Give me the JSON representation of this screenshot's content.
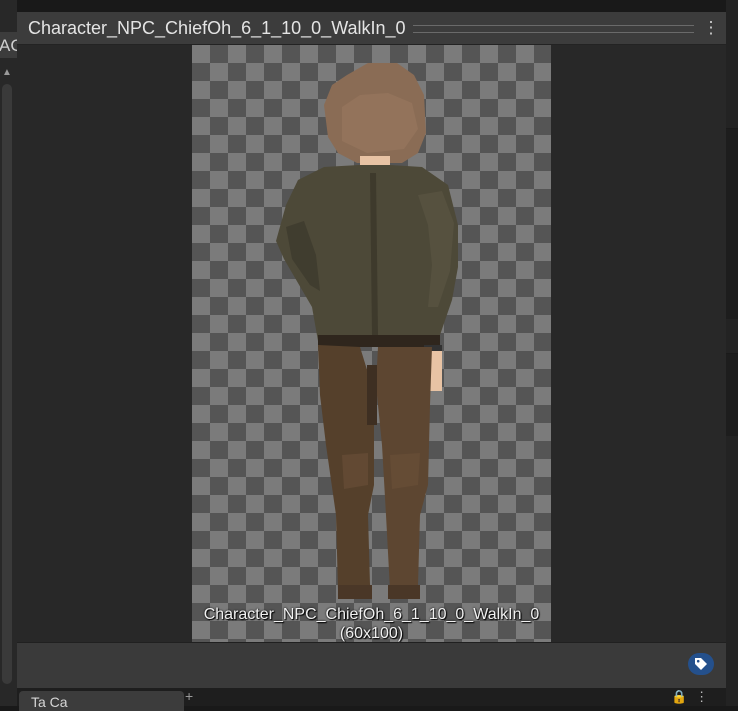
{
  "left_panel": {
    "tab_label": "AC"
  },
  "inspector": {
    "title": "Character_NPC_ChiefOh_6_1_10_0_WalkIn_0",
    "menu_icon": "kebab-menu-icon"
  },
  "preview": {
    "caption_name": "Character_NPC_ChiefOh_6_1_10_0_WalkIn_0",
    "caption_size": "(60x100)",
    "background": "checkerboard-transparency"
  },
  "bottom_bar": {
    "tag_icon": "tag-icon",
    "tag_color": "#24508c"
  },
  "bottom_tabs": {
    "first_tab_label": "Ta  Ca",
    "extra": "+"
  },
  "colors": {
    "window_bg": "#282828",
    "header_bg": "#3c3c3c",
    "hair": "#8a6c55",
    "jacket": "#4d4938",
    "pants": "#55402b",
    "skin": "#e8c3a4"
  }
}
